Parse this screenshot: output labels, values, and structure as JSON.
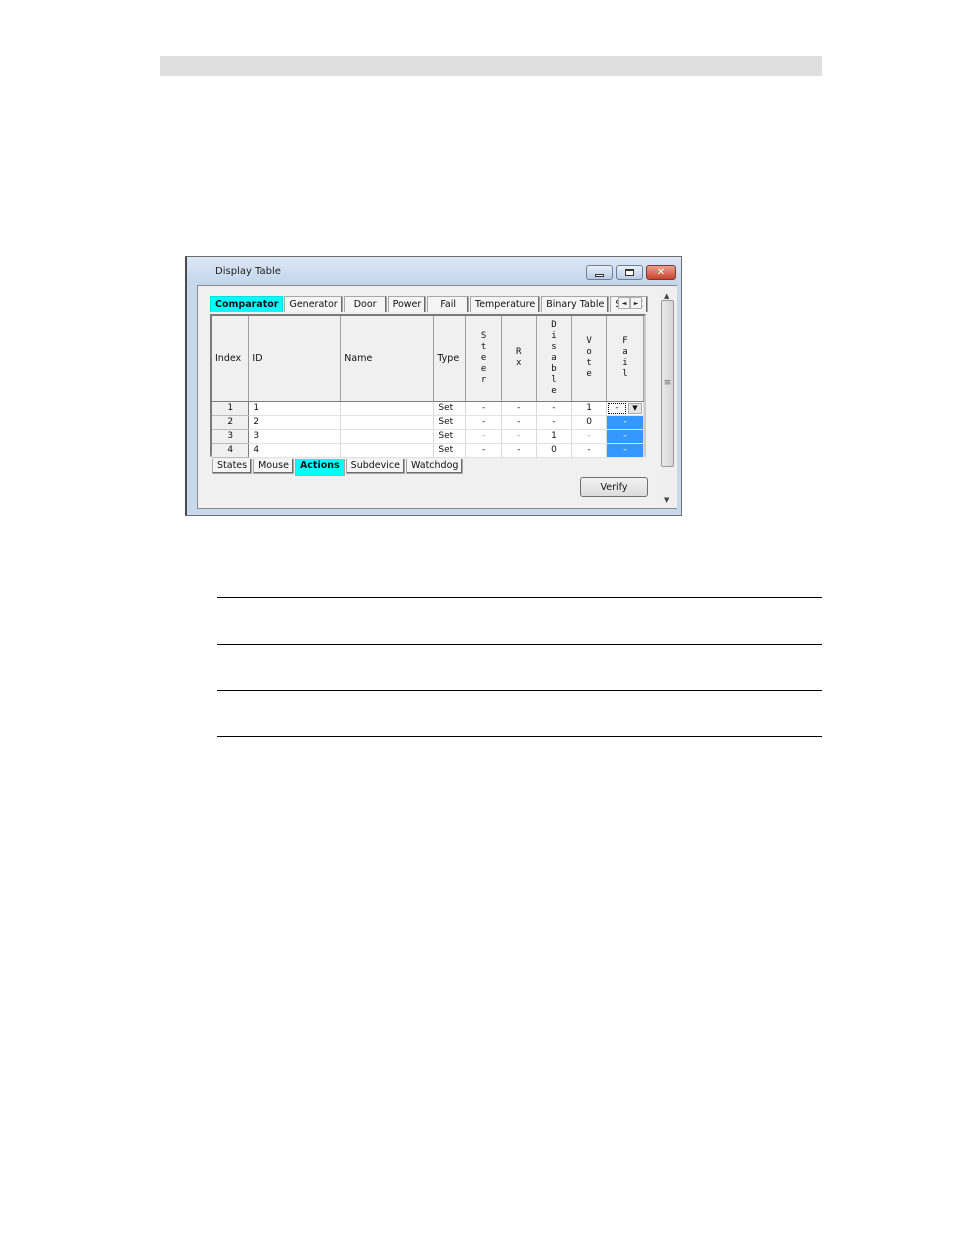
{
  "window": {
    "title": "Display Table",
    "controls": {
      "minimize": "minimize",
      "maximize": "maximize",
      "close": "✕"
    }
  },
  "top_tabs": [
    {
      "label": "Comparator",
      "active": true
    },
    {
      "label": "Generator",
      "active": false
    },
    {
      "label": "Door",
      "active": false
    },
    {
      "label": "Power",
      "active": false
    },
    {
      "label": "Fail",
      "active": false
    },
    {
      "label": "Temperature",
      "active": false
    },
    {
      "label": "Binary Table",
      "active": false
    },
    {
      "label": "Sub C",
      "active": false
    }
  ],
  "tab_scroll": {
    "left": "◄",
    "right": "►"
  },
  "table": {
    "columns": [
      "Index",
      "ID",
      "Name",
      "Type",
      "Steer",
      "Rx",
      "Disable",
      "Vote",
      "Fail"
    ],
    "rows": [
      {
        "index": "1",
        "id": "1",
        "name": "",
        "type": "Set",
        "steer": "-",
        "rx": "-",
        "disable": "-",
        "vote": "1",
        "fail": "-"
      },
      {
        "index": "2",
        "id": "2",
        "name": "",
        "type": "Set",
        "steer": "-",
        "rx": "-",
        "disable": "-",
        "vote": "0",
        "fail": "-"
      },
      {
        "index": "3",
        "id": "3",
        "name": "",
        "type": "Set",
        "steer": "-",
        "rx": "-",
        "disable": "1",
        "vote": "-",
        "fail": "-"
      },
      {
        "index": "4",
        "id": "4",
        "name": "",
        "type": "Set",
        "steer": "-",
        "rx": "-",
        "disable": "0",
        "vote": "-",
        "fail": "-"
      }
    ],
    "selection_color": "#3399ff"
  },
  "bottom_tabs": [
    {
      "label": "States",
      "active": false
    },
    {
      "label": "Mouse",
      "active": false
    },
    {
      "label": "Actions",
      "active": true
    },
    {
      "label": "Subdevice",
      "active": false
    },
    {
      "label": "Watchdog",
      "active": false
    }
  ],
  "buttons": {
    "verify": "Verify"
  },
  "colors": {
    "active_tab": "#00ffff"
  }
}
